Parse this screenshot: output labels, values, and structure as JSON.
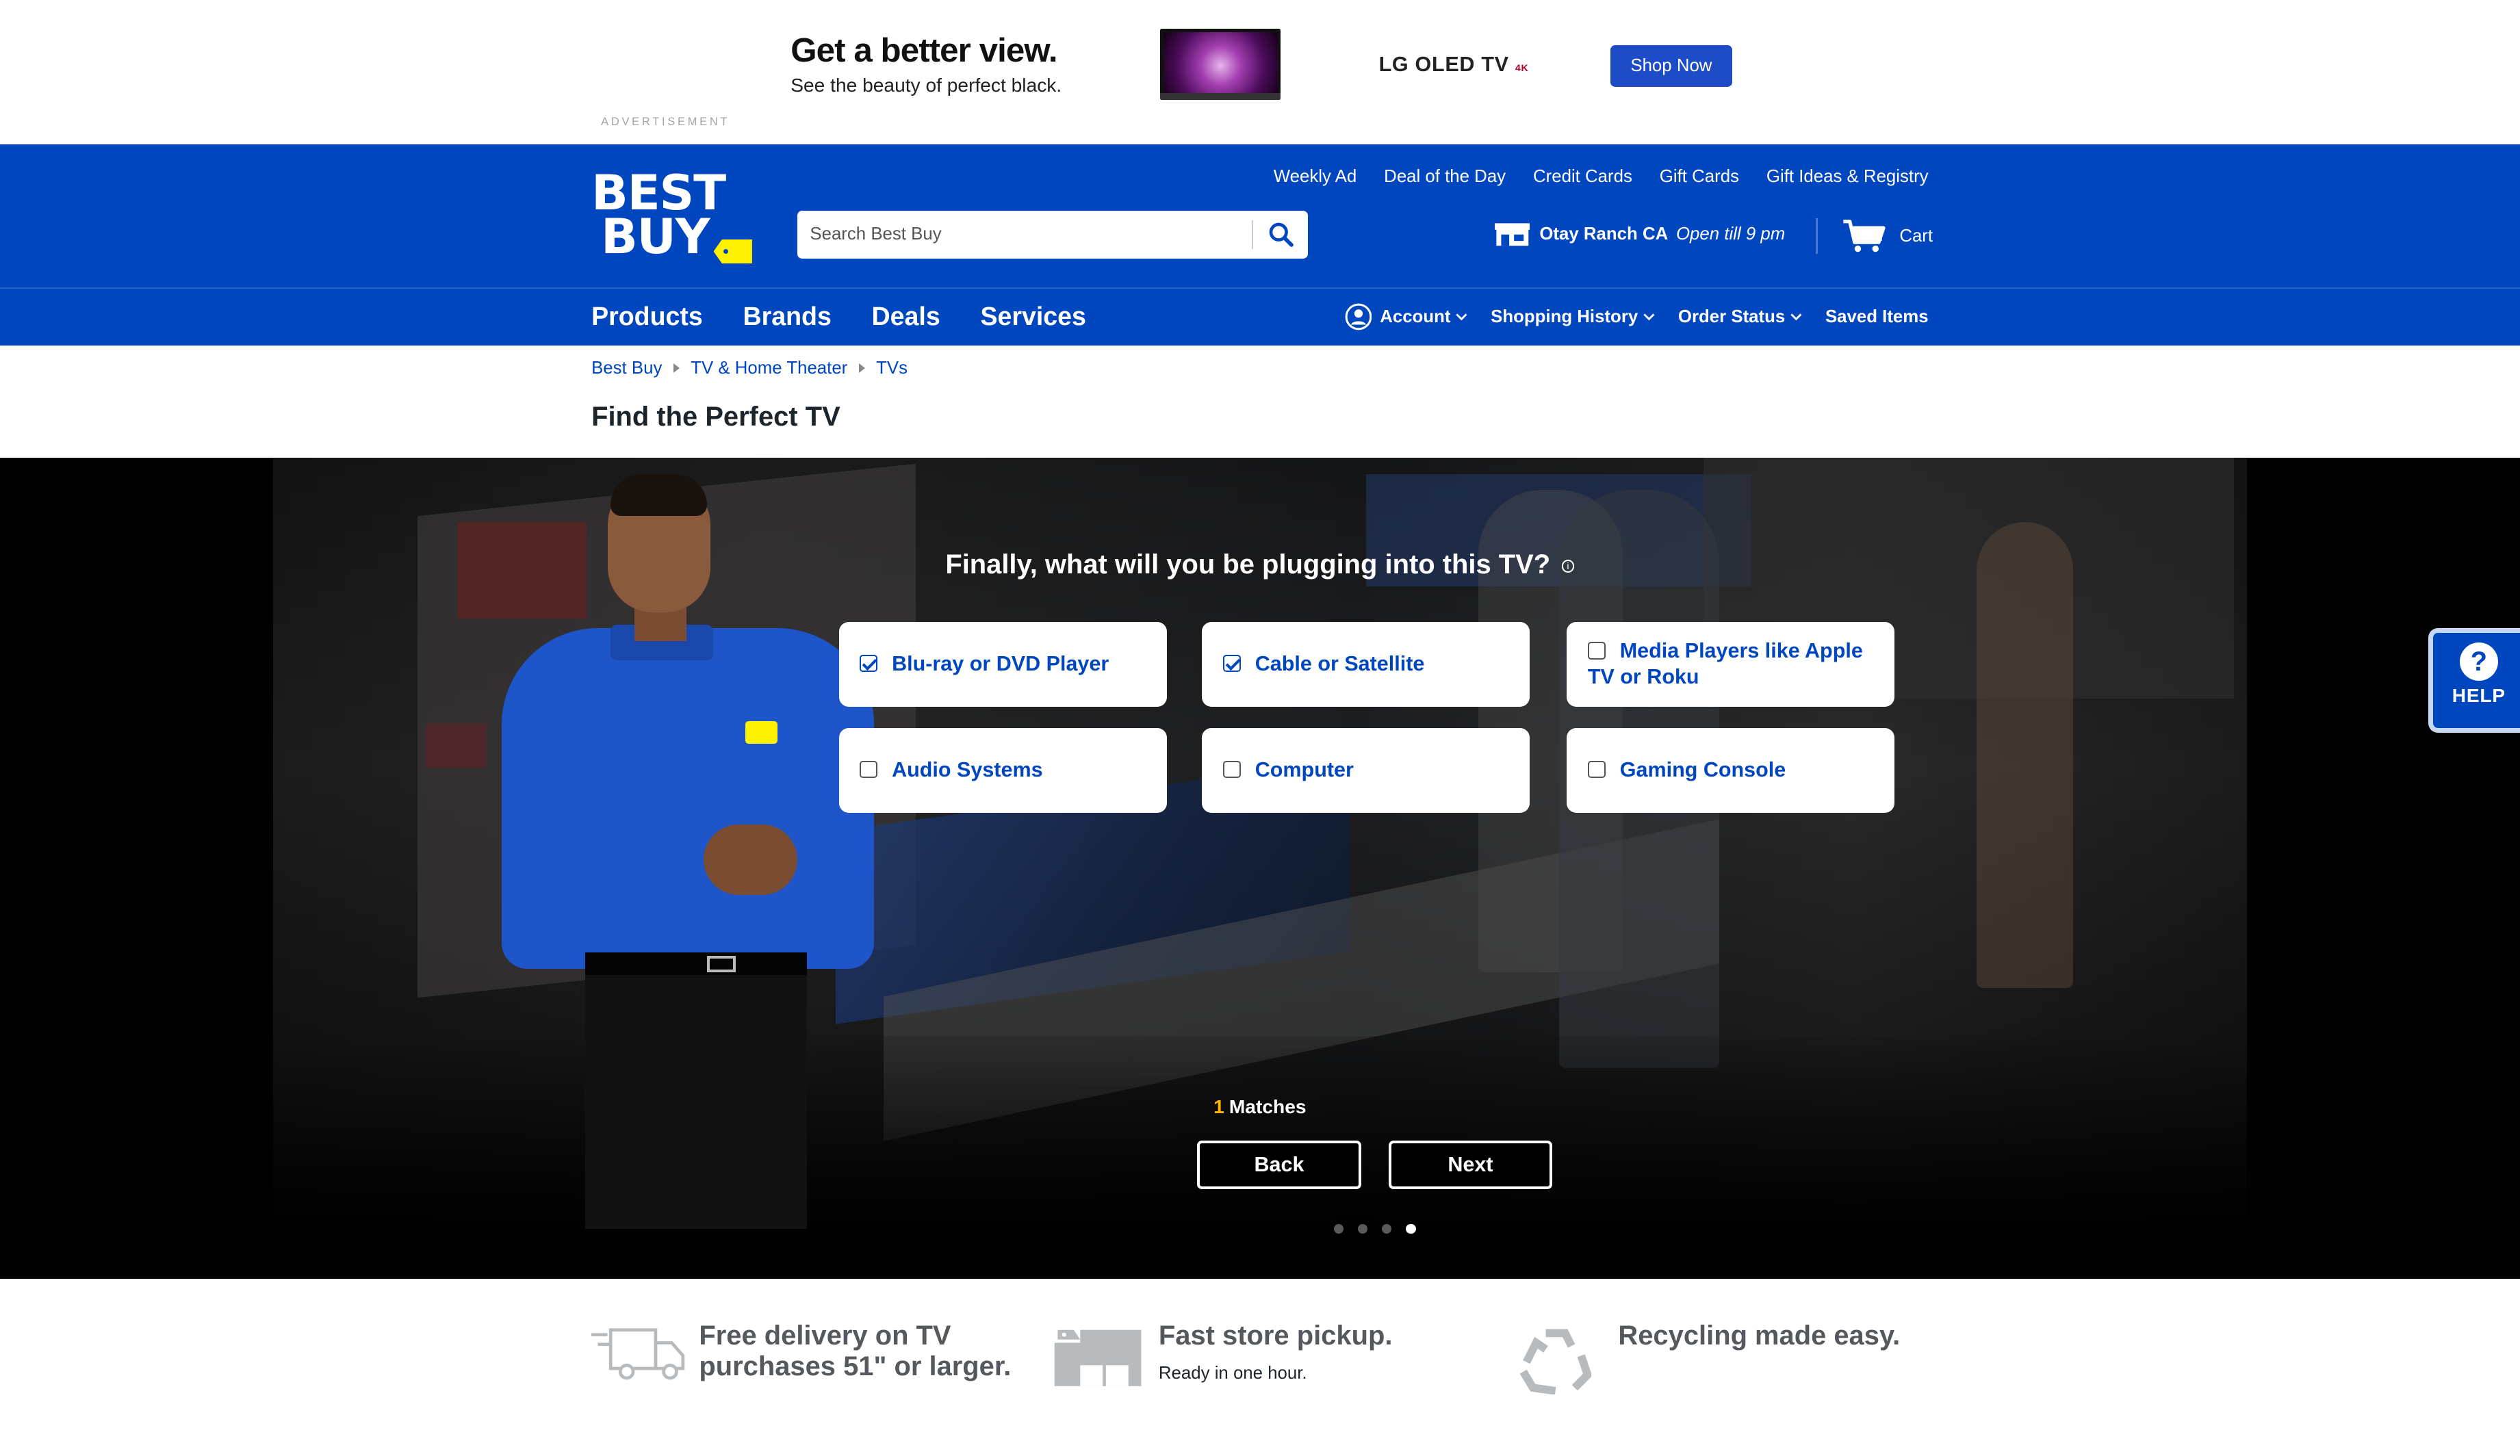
{
  "ad": {
    "label": "Advertisement",
    "headline": "Get a better view.",
    "subline": "See the beauty of perfect black.",
    "brand": "LG OLED TV",
    "brand_suffix": "4K",
    "cta": "Shop Now"
  },
  "header": {
    "logo_line1": "BEST",
    "logo_line2": "BUY",
    "top_links": [
      "Weekly Ad",
      "Deal of the Day",
      "Credit Cards",
      "Gift Cards",
      "Gift Ideas & Registry"
    ],
    "search_placeholder": "Search Best Buy",
    "store_name": "Otay Ranch CA",
    "store_hours": "Open till 9 pm",
    "cart_label": "Cart"
  },
  "nav": {
    "main": [
      "Products",
      "Brands",
      "Deals",
      "Services"
    ],
    "account": "Account",
    "shopping_history": "Shopping History",
    "order_status": "Order Status",
    "saved_items": "Saved Items"
  },
  "breadcrumb": [
    "Best Buy",
    "TV & Home Theater",
    "TVs"
  ],
  "page_title": "Find the Perfect TV",
  "quiz": {
    "question": "Finally, what will you be plugging into this TV?",
    "options": [
      {
        "label": "Blu-ray or DVD Player",
        "checked": true
      },
      {
        "label": "Cable or Satellite",
        "checked": true
      },
      {
        "label": "Media Players like Apple TV or Roku",
        "checked": false
      },
      {
        "label": "Audio Systems",
        "checked": false
      },
      {
        "label": "Computer",
        "checked": false
      },
      {
        "label": "Gaming Console",
        "checked": false
      }
    ],
    "match_count": "1",
    "match_label": "Matches",
    "back_label": "Back",
    "next_label": "Next",
    "steps_total": 4,
    "current_step": 4
  },
  "help": {
    "label": "HELP"
  },
  "features": [
    {
      "title": "Free delivery on TV purchases 51\" or larger.",
      "sub": ""
    },
    {
      "title": "Fast store pickup.",
      "sub": "Ready in one hour."
    },
    {
      "title": "Recycling made easy.",
      "sub": ""
    }
  ],
  "colors": {
    "brand_blue": "#0046be",
    "brand_yellow": "#fff200",
    "match_accent": "#ffb400"
  }
}
